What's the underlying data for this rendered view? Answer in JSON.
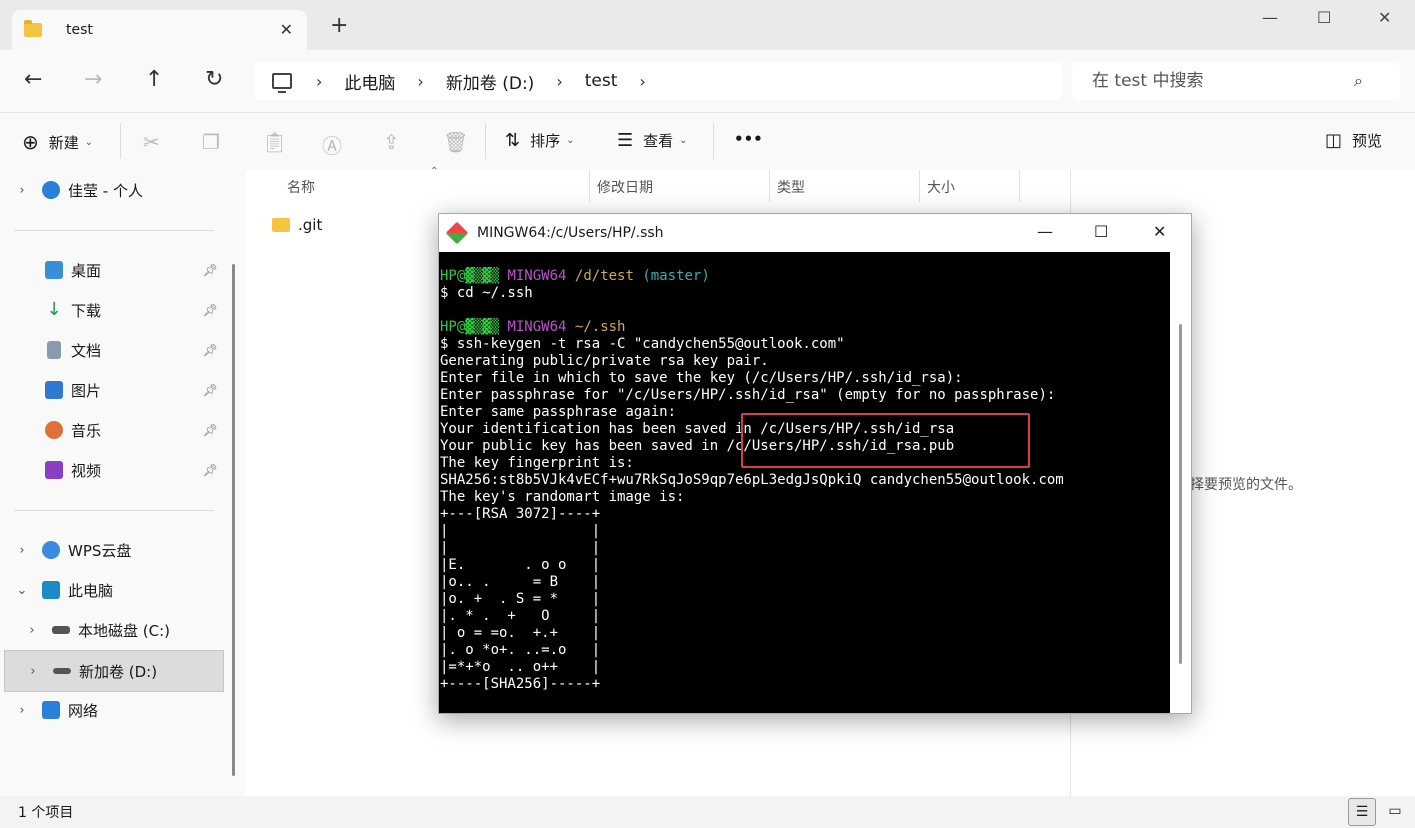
{
  "window": {
    "tab_title": "test",
    "new_tab": "+",
    "minimize": "—",
    "maximize": "☐",
    "close": "✕"
  },
  "nav": {
    "back": "←",
    "forward": "→",
    "up": "↑",
    "refresh": "↻"
  },
  "breadcrumb": [
    "此电脑",
    "新加卷 (D:)",
    "test"
  ],
  "search": {
    "placeholder": "在 test 中搜索"
  },
  "toolbar": {
    "new_label": "新建",
    "sort_label": "排序",
    "view_label": "查看",
    "more": "•••",
    "preview_label": "预览"
  },
  "sidebar": {
    "account": "佳莹 - 个人",
    "quick": [
      {
        "label": "桌面",
        "icon": "desktop-icon"
      },
      {
        "label": "下载",
        "icon": "download-icon"
      },
      {
        "label": "文档",
        "icon": "document-icon"
      },
      {
        "label": "图片",
        "icon": "pictures-icon"
      },
      {
        "label": "音乐",
        "icon": "music-icon"
      },
      {
        "label": "视频",
        "icon": "video-icon"
      }
    ],
    "wps": "WPS云盘",
    "this_pc": "此电脑",
    "drive_c": "本地磁盘 (C:)",
    "drive_d": "新加卷 (D:)",
    "network": "网络"
  },
  "columns": [
    "名称",
    "修改日期",
    "类型",
    "大小"
  ],
  "files": [
    {
      "name": ".git"
    }
  ],
  "preview_message": "择要预览的文件。",
  "status": {
    "count": "1 个项目"
  },
  "terminal": {
    "title": "MINGW64:/c/Users/HP/.ssh",
    "host1": "HP@",
    "shell": "MINGW64",
    "path1": "/d/test",
    "branch": "(master)",
    "cmd1": "$ cd ~/.ssh",
    "path2": "~/.ssh",
    "cmd2": "$ ssh-keygen -t rsa -C \"candychen55@outlook.com\"",
    "out1": "Generating public/private rsa key pair.",
    "out2": "Enter file in which to save the key (/c/Users/HP/.ssh/id_rsa):",
    "out3": "Enter passphrase for \"/c/Users/HP/.ssh/id_rsa\" (empty for no passphrase):",
    "out4": "Enter same passphrase again:",
    "out5": "Your identification has been saved in /c/Users/HP/.ssh/id_rsa",
    "out6": "Your public key has been saved in /c/Users/HP/.ssh/id_rsa.pub",
    "out7": "The key fingerprint is:",
    "out8": "SHA256:st8b5VJk4vECf+wu7RkSqJoS9qp7e6pL3edgJsQpkiQ candychen55@outlook.com",
    "out9": "The key's randomart image is:",
    "art": "+---[RSA 3072]----+\n|                 |\n|                 |\n|E.       . o o   |\n|o.. .     = B    |\n|o. +  . S = *    |\n|. * .  +   O     |\n| o = =o.  +.+    |\n|. o *o+. ..=.o   |\n|=*+*o  .. o++    |\n+----[SHA256]-----+"
  }
}
